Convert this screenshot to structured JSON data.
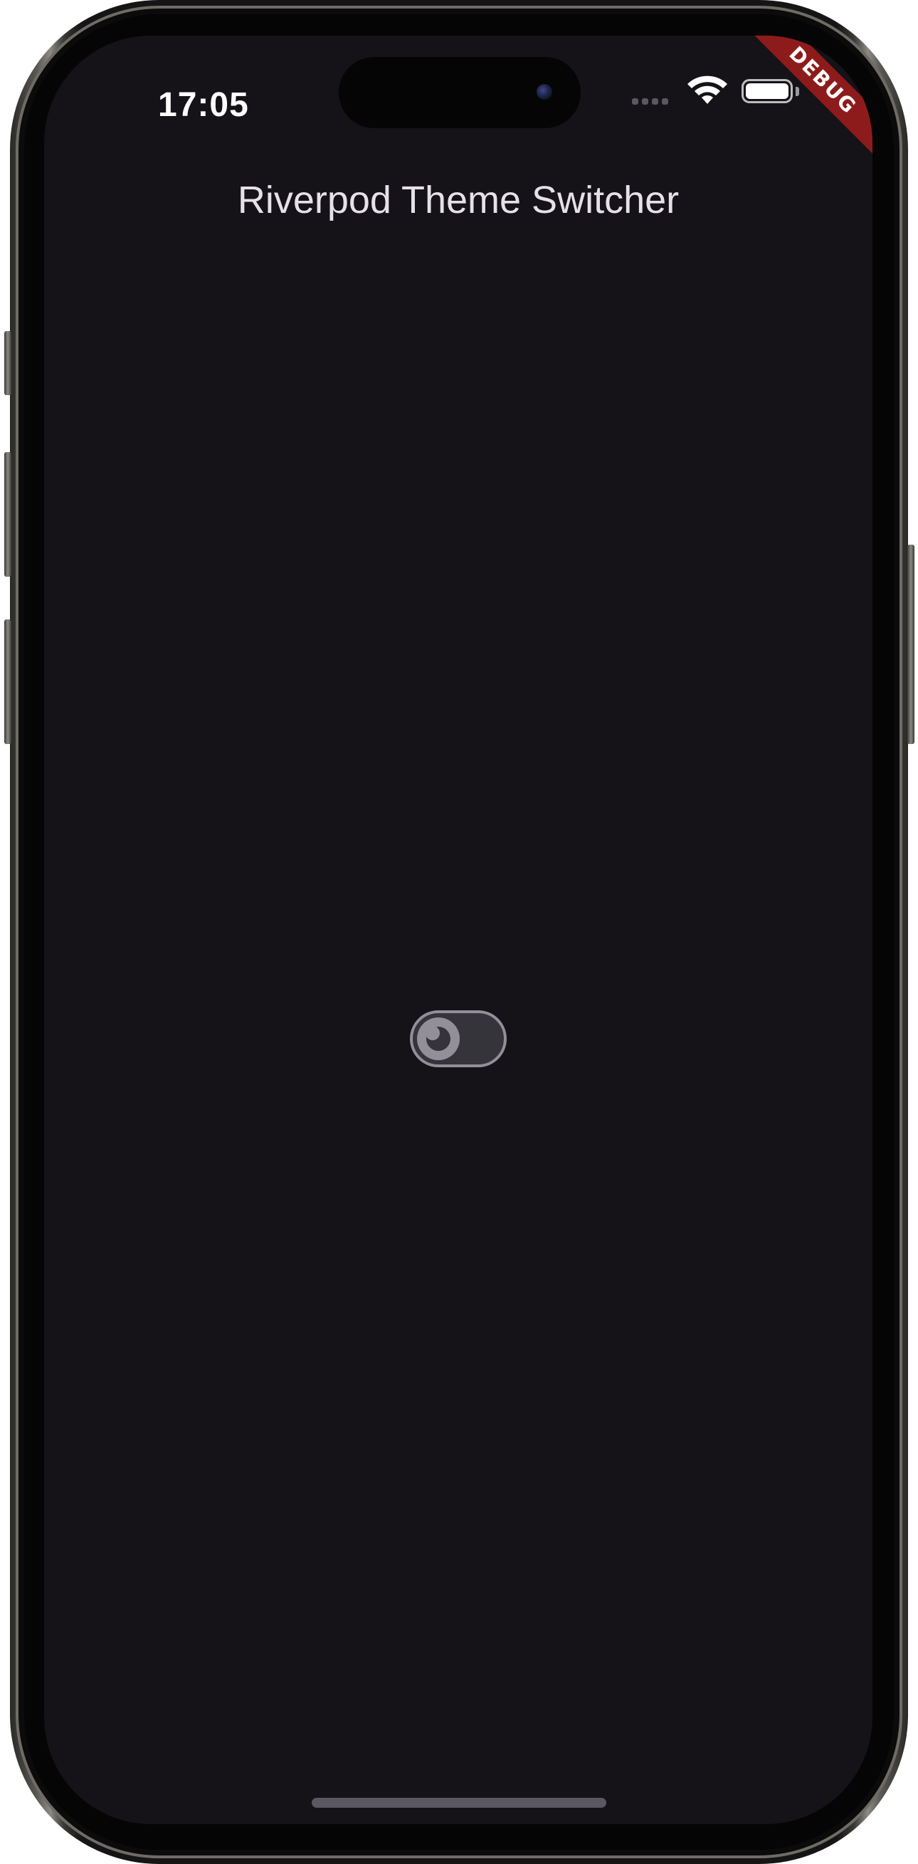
{
  "status_bar": {
    "time": "17:05"
  },
  "debug_banner": {
    "label": "DEBUG",
    "color": "#8e1b1b"
  },
  "app_bar": {
    "title": "Riverpod Theme Switcher"
  },
  "theme_switch": {
    "state": "off",
    "thumb_icon": "moon-icon",
    "track_color": "#36343b",
    "outline_color": "#938f99"
  },
  "colors": {
    "background": "#151218",
    "title_text": "#e6e0e9"
  }
}
